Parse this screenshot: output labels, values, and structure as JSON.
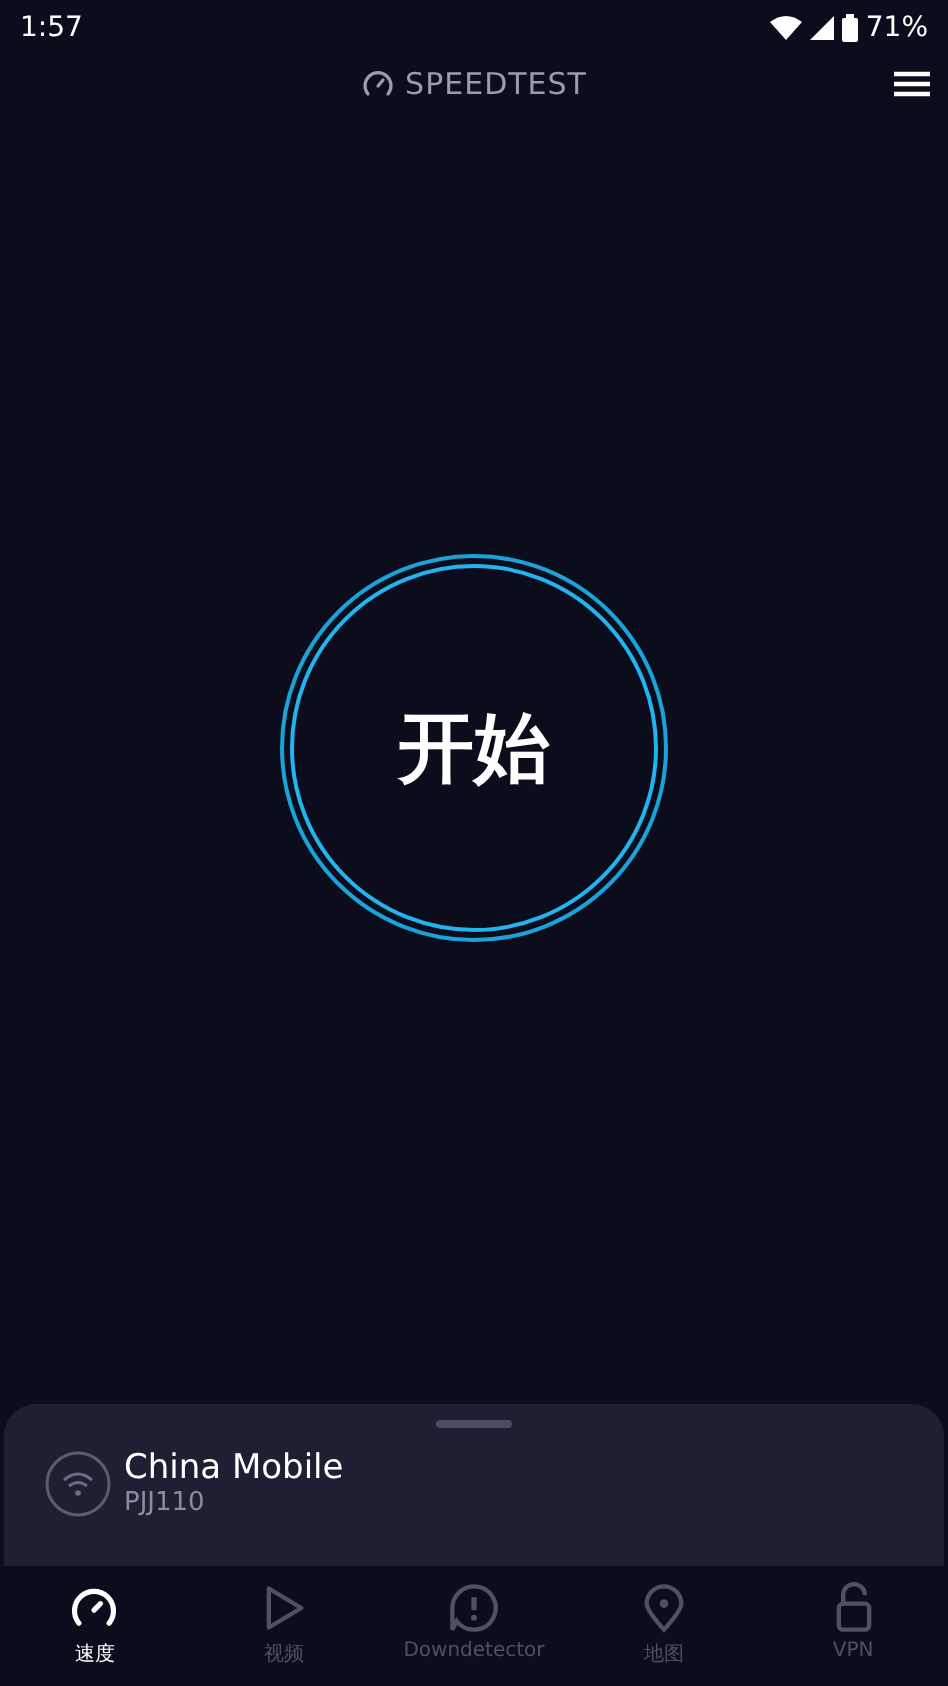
{
  "status_bar": {
    "time": "1:57",
    "battery": "71%"
  },
  "header": {
    "title": "SPEEDTEST"
  },
  "start_button": {
    "label": "开始"
  },
  "network": {
    "provider": "China Mobile",
    "device": "PJJ110"
  },
  "nav": [
    {
      "label": "速度",
      "kind": "gauge",
      "selected": true
    },
    {
      "label": "视频",
      "kind": "play",
      "selected": false
    },
    {
      "label": "Downdetector",
      "kind": "alert",
      "selected": false
    },
    {
      "label": "地图",
      "kind": "pin",
      "selected": false
    },
    {
      "label": "VPN",
      "kind": "lock",
      "selected": false
    }
  ]
}
